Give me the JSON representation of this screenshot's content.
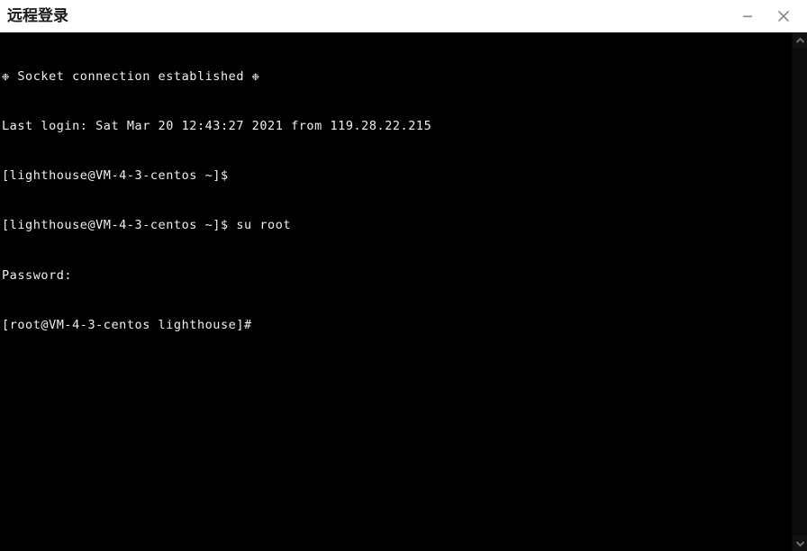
{
  "window": {
    "title": "远程登录",
    "controls": {
      "minimize_label": "—",
      "minimize_name": "minimize",
      "close_label": "×",
      "close_name": "close"
    },
    "colors": {
      "titlebar_bg": "#ffffff",
      "title_fg": "#1a1a1a",
      "terminal_bg": "#000000",
      "terminal_fg": "#f0f0f0",
      "control_fg": "#7a7a7a",
      "scrollbar_bg": "#121212",
      "scrollbar_arrow": "#6a6a6a"
    }
  },
  "terminal": {
    "lines": [
      "❉ Socket connection established ❉",
      "Last login: Sat Mar 20 12:43:27 2021 from 119.28.22.215",
      "[lighthouse@VM-4-3-centos ~]$",
      "[lighthouse@VM-4-3-centos ~]$ su root",
      "Password:",
      "[root@VM-4-3-centos lighthouse]#"
    ],
    "banner": "❉ Socket connection established ❉",
    "last_login": "Last login: Sat Mar 20 12:43:27 2021 from 119.28.22.215",
    "prompt_user": "[lighthouse@VM-4-3-centos ~]$",
    "command_su": "[lighthouse@VM-4-3-centos ~]$ su root",
    "password_prompt": "Password:",
    "prompt_root": "[root@VM-4-3-centos lighthouse]#",
    "host": "VM-4-3-centos",
    "user": "lighthouse",
    "root_user": "root",
    "login_ip": "119.28.22.215",
    "login_date": "Sat Mar 20 12:43:27 2021"
  },
  "scrollbar": {
    "up_arrow": "scroll-up",
    "down_arrow": "scroll-down"
  }
}
